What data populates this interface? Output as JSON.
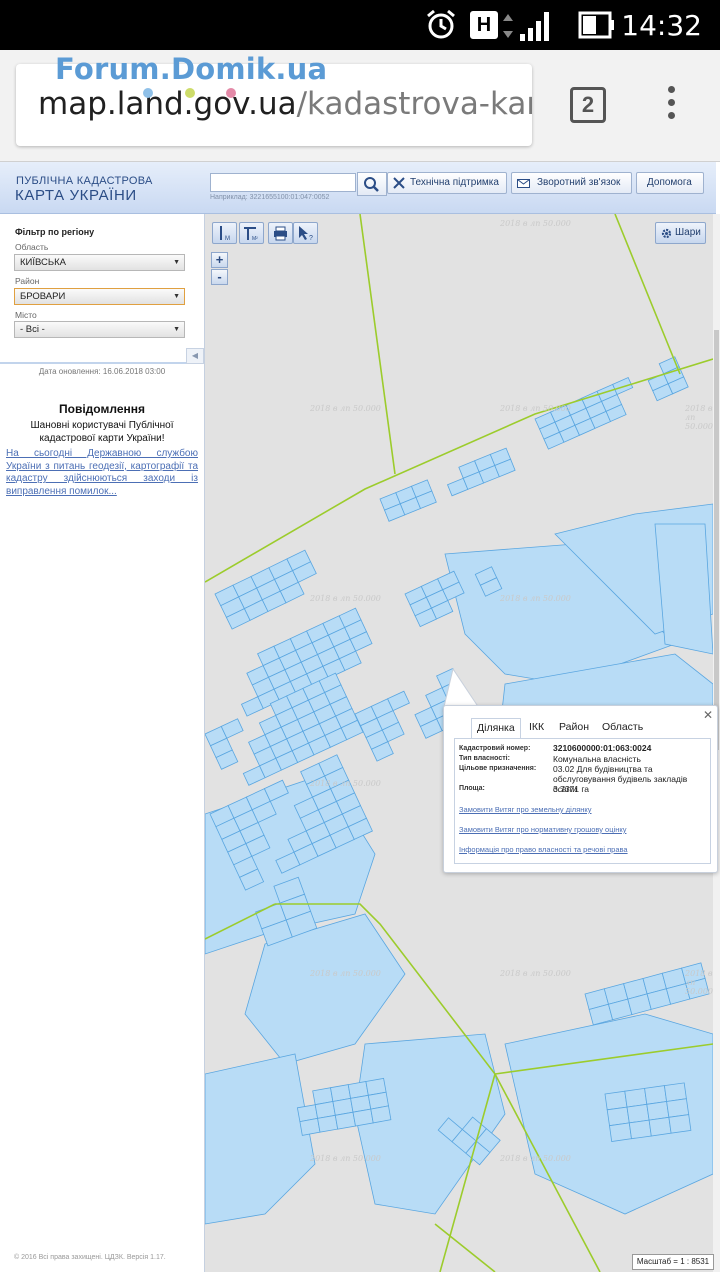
{
  "status_bar": {
    "time": "14:32",
    "network_letter": "H"
  },
  "browser": {
    "watermark": "Forum.Domik.ua",
    "url_host": "map.land.gov.ua",
    "url_path": "/kadastrova-karta",
    "tab_count": "2"
  },
  "header": {
    "logo_line1": "ПУБЛІЧНА КАДАСТРОВА",
    "logo_line2": "КАРТА УКРАЇНИ",
    "search_value": "",
    "search_hint": "Наприклад: 3221655100:01:047:0052",
    "support_label": "Технічна підтримка",
    "feedback_label": "Зворотний зв'язок",
    "help_label": "Допомога"
  },
  "sidebar": {
    "filter_title": "Фільтр по регіону",
    "oblast_label": "Область",
    "oblast_value": "КИЇВСЬКА",
    "rayon_label": "Район",
    "rayon_value": "БРОВАРИ",
    "city_label": "Місто",
    "city_value": "- Всі -",
    "update_date": "Дата оновлення: 16.06.2018 03:00",
    "notice_title": "Повідомлення",
    "notice_text": "Шановні користувачі Публічної кадастрової карти України!",
    "notice_link": "На сьогодні Державною службою України з питань геодезії, картографії та кадастру здійснюються заходи із виправлення помилок...",
    "copyright": "© 2016 Всі права захищені. ЦДЗК. Версія 1.17."
  },
  "map": {
    "layers_label": "Шари",
    "zoom_in": "+",
    "zoom_out": "-",
    "scale_text": "Масштаб = 1 : 8531",
    "stamp_text": "2018 в лп 50.000"
  },
  "popup": {
    "tabs": [
      "Ділянка",
      "ІКК",
      "Район",
      "Область"
    ],
    "active_tab": "Ділянка",
    "rows": [
      {
        "label": "Кадастровий номер:",
        "value": "3210600000:01:063:0024"
      },
      {
        "label": "Тип власності:",
        "value": "Комунальна власність"
      },
      {
        "label": "Цільове призначення:",
        "value": "03.02 Для будівництва та обслуговування будівель закладів освіти"
      },
      {
        "label": "Площа:",
        "value": "3.7371 га"
      }
    ],
    "links": [
      "Замовити Витяг про земельну ділянку",
      "Замовити Витяг про нормативну грошову оцінку",
      "Інформація про право власності та речові права"
    ]
  },
  "colors": {
    "parcel_fill": "#b8dcf6",
    "parcel_stroke": "#5aa6e0",
    "boundary_line": "#9ccc2c",
    "link": "#4c6fb5",
    "header_blue": "#2b4d86"
  }
}
